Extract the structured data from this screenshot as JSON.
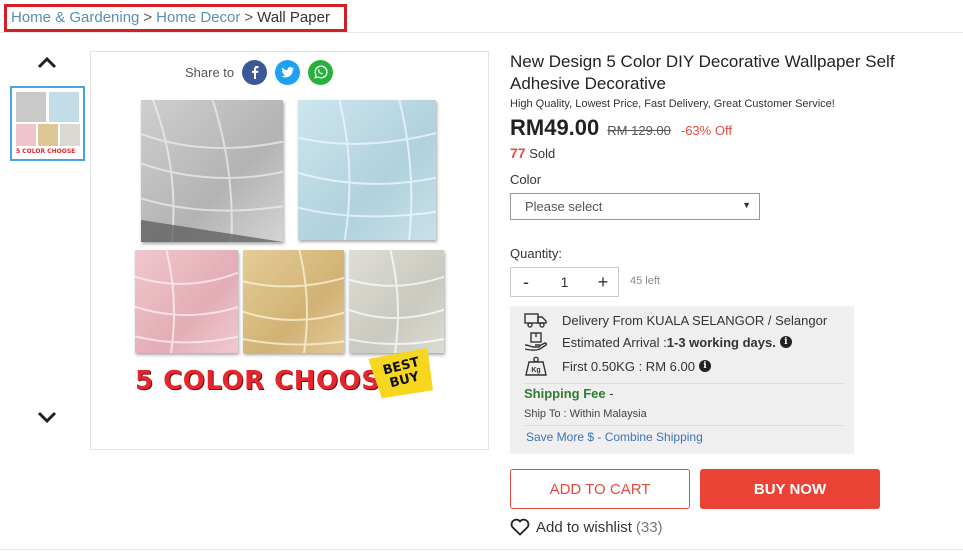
{
  "breadcrumb": {
    "items": [
      "Home & Gardening",
      "Home Decor"
    ],
    "separator": ">",
    "current": "Wall Paper",
    "highlight_color": "#d61e25"
  },
  "gallery": {
    "thumbnail_label": "5 COLOR CHOOSE",
    "up_icon": "chevron-up-icon",
    "down_icon": "chevron-down-icon"
  },
  "share": {
    "label": "Share to",
    "networks": [
      {
        "name": "facebook-icon",
        "color": "#3b5998"
      },
      {
        "name": "twitter-icon",
        "color": "#1da1f2"
      },
      {
        "name": "whatsapp-icon",
        "color": "#25b13b"
      }
    ]
  },
  "product_image": {
    "banner_text": "5 COLOR CHOOSE",
    "badge_line1": "BEST",
    "badge_line2": "BUY",
    "swatches": [
      "#c3c3c3",
      "#bcd9e4",
      "#ecc1c7",
      "#dcc38f",
      "#d6d6cf"
    ]
  },
  "product": {
    "title": "New Design 5 Color DIY Decorative Wallpaper Self Adhesive Decorative",
    "subtitle": "High Quality, Lowest Price, Fast Delivery, Great Customer Service!",
    "price": "RM49.00",
    "original_price": "RM 129.00",
    "discount": "-63% Off",
    "sold_count": "77",
    "sold_label": "Sold"
  },
  "options": {
    "color_label": "Color",
    "color_value": "Please select",
    "quantity_label": "Quantity:",
    "decrement": "-",
    "quantity": "1",
    "increment": "+",
    "stock_left": "45 left"
  },
  "shipping": {
    "delivery": "Delivery From KUALA SELANGOR / Selangor",
    "arrival_label": "Estimated Arrival : ",
    "arrival_value": "1-3 working days.",
    "first_rate": "First 0.50KG : RM 6.00",
    "fee_label": "Shipping Fee",
    "fee_value": "-",
    "ship_to": "Ship To : Within Malaysia",
    "save_more": "Save More $ - Combine Shipping"
  },
  "actions": {
    "add_to_cart": "ADD TO CART",
    "buy_now": "BUY NOW",
    "wishlist": "Add to wishlist",
    "wishlist_count": "(33)",
    "accent": "#ea4335"
  }
}
